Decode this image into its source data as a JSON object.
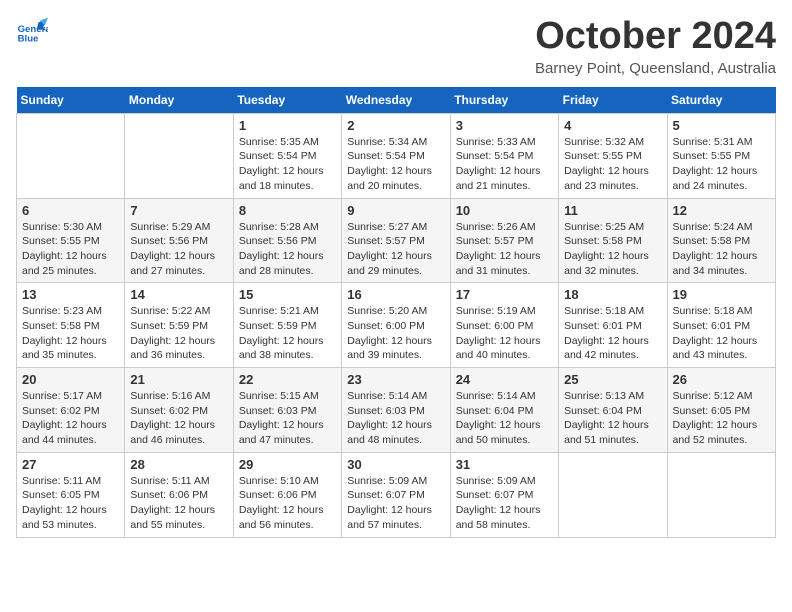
{
  "header": {
    "logo_line1": "General",
    "logo_line2": "Blue",
    "month": "October 2024",
    "location": "Barney Point, Queensland, Australia"
  },
  "weekdays": [
    "Sunday",
    "Monday",
    "Tuesday",
    "Wednesday",
    "Thursday",
    "Friday",
    "Saturday"
  ],
  "weeks": [
    [
      {
        "day": "",
        "sunrise": "",
        "sunset": "",
        "daylight": ""
      },
      {
        "day": "",
        "sunrise": "",
        "sunset": "",
        "daylight": ""
      },
      {
        "day": "1",
        "sunrise": "Sunrise: 5:35 AM",
        "sunset": "Sunset: 5:54 PM",
        "daylight": "Daylight: 12 hours and 18 minutes."
      },
      {
        "day": "2",
        "sunrise": "Sunrise: 5:34 AM",
        "sunset": "Sunset: 5:54 PM",
        "daylight": "Daylight: 12 hours and 20 minutes."
      },
      {
        "day": "3",
        "sunrise": "Sunrise: 5:33 AM",
        "sunset": "Sunset: 5:54 PM",
        "daylight": "Daylight: 12 hours and 21 minutes."
      },
      {
        "day": "4",
        "sunrise": "Sunrise: 5:32 AM",
        "sunset": "Sunset: 5:55 PM",
        "daylight": "Daylight: 12 hours and 23 minutes."
      },
      {
        "day": "5",
        "sunrise": "Sunrise: 5:31 AM",
        "sunset": "Sunset: 5:55 PM",
        "daylight": "Daylight: 12 hours and 24 minutes."
      }
    ],
    [
      {
        "day": "6",
        "sunrise": "Sunrise: 5:30 AM",
        "sunset": "Sunset: 5:55 PM",
        "daylight": "Daylight: 12 hours and 25 minutes."
      },
      {
        "day": "7",
        "sunrise": "Sunrise: 5:29 AM",
        "sunset": "Sunset: 5:56 PM",
        "daylight": "Daylight: 12 hours and 27 minutes."
      },
      {
        "day": "8",
        "sunrise": "Sunrise: 5:28 AM",
        "sunset": "Sunset: 5:56 PM",
        "daylight": "Daylight: 12 hours and 28 minutes."
      },
      {
        "day": "9",
        "sunrise": "Sunrise: 5:27 AM",
        "sunset": "Sunset: 5:57 PM",
        "daylight": "Daylight: 12 hours and 29 minutes."
      },
      {
        "day": "10",
        "sunrise": "Sunrise: 5:26 AM",
        "sunset": "Sunset: 5:57 PM",
        "daylight": "Daylight: 12 hours and 31 minutes."
      },
      {
        "day": "11",
        "sunrise": "Sunrise: 5:25 AM",
        "sunset": "Sunset: 5:58 PM",
        "daylight": "Daylight: 12 hours and 32 minutes."
      },
      {
        "day": "12",
        "sunrise": "Sunrise: 5:24 AM",
        "sunset": "Sunset: 5:58 PM",
        "daylight": "Daylight: 12 hours and 34 minutes."
      }
    ],
    [
      {
        "day": "13",
        "sunrise": "Sunrise: 5:23 AM",
        "sunset": "Sunset: 5:58 PM",
        "daylight": "Daylight: 12 hours and 35 minutes."
      },
      {
        "day": "14",
        "sunrise": "Sunrise: 5:22 AM",
        "sunset": "Sunset: 5:59 PM",
        "daylight": "Daylight: 12 hours and 36 minutes."
      },
      {
        "day": "15",
        "sunrise": "Sunrise: 5:21 AM",
        "sunset": "Sunset: 5:59 PM",
        "daylight": "Daylight: 12 hours and 38 minutes."
      },
      {
        "day": "16",
        "sunrise": "Sunrise: 5:20 AM",
        "sunset": "Sunset: 6:00 PM",
        "daylight": "Daylight: 12 hours and 39 minutes."
      },
      {
        "day": "17",
        "sunrise": "Sunrise: 5:19 AM",
        "sunset": "Sunset: 6:00 PM",
        "daylight": "Daylight: 12 hours and 40 minutes."
      },
      {
        "day": "18",
        "sunrise": "Sunrise: 5:18 AM",
        "sunset": "Sunset: 6:01 PM",
        "daylight": "Daylight: 12 hours and 42 minutes."
      },
      {
        "day": "19",
        "sunrise": "Sunrise: 5:18 AM",
        "sunset": "Sunset: 6:01 PM",
        "daylight": "Daylight: 12 hours and 43 minutes."
      }
    ],
    [
      {
        "day": "20",
        "sunrise": "Sunrise: 5:17 AM",
        "sunset": "Sunset: 6:02 PM",
        "daylight": "Daylight: 12 hours and 44 minutes."
      },
      {
        "day": "21",
        "sunrise": "Sunrise: 5:16 AM",
        "sunset": "Sunset: 6:02 PM",
        "daylight": "Daylight: 12 hours and 46 minutes."
      },
      {
        "day": "22",
        "sunrise": "Sunrise: 5:15 AM",
        "sunset": "Sunset: 6:03 PM",
        "daylight": "Daylight: 12 hours and 47 minutes."
      },
      {
        "day": "23",
        "sunrise": "Sunrise: 5:14 AM",
        "sunset": "Sunset: 6:03 PM",
        "daylight": "Daylight: 12 hours and 48 minutes."
      },
      {
        "day": "24",
        "sunrise": "Sunrise: 5:14 AM",
        "sunset": "Sunset: 6:04 PM",
        "daylight": "Daylight: 12 hours and 50 minutes."
      },
      {
        "day": "25",
        "sunrise": "Sunrise: 5:13 AM",
        "sunset": "Sunset: 6:04 PM",
        "daylight": "Daylight: 12 hours and 51 minutes."
      },
      {
        "day": "26",
        "sunrise": "Sunrise: 5:12 AM",
        "sunset": "Sunset: 6:05 PM",
        "daylight": "Daylight: 12 hours and 52 minutes."
      }
    ],
    [
      {
        "day": "27",
        "sunrise": "Sunrise: 5:11 AM",
        "sunset": "Sunset: 6:05 PM",
        "daylight": "Daylight: 12 hours and 53 minutes."
      },
      {
        "day": "28",
        "sunrise": "Sunrise: 5:11 AM",
        "sunset": "Sunset: 6:06 PM",
        "daylight": "Daylight: 12 hours and 55 minutes."
      },
      {
        "day": "29",
        "sunrise": "Sunrise: 5:10 AM",
        "sunset": "Sunset: 6:06 PM",
        "daylight": "Daylight: 12 hours and 56 minutes."
      },
      {
        "day": "30",
        "sunrise": "Sunrise: 5:09 AM",
        "sunset": "Sunset: 6:07 PM",
        "daylight": "Daylight: 12 hours and 57 minutes."
      },
      {
        "day": "31",
        "sunrise": "Sunrise: 5:09 AM",
        "sunset": "Sunset: 6:07 PM",
        "daylight": "Daylight: 12 hours and 58 minutes."
      },
      {
        "day": "",
        "sunrise": "",
        "sunset": "",
        "daylight": ""
      },
      {
        "day": "",
        "sunrise": "",
        "sunset": "",
        "daylight": ""
      }
    ]
  ]
}
